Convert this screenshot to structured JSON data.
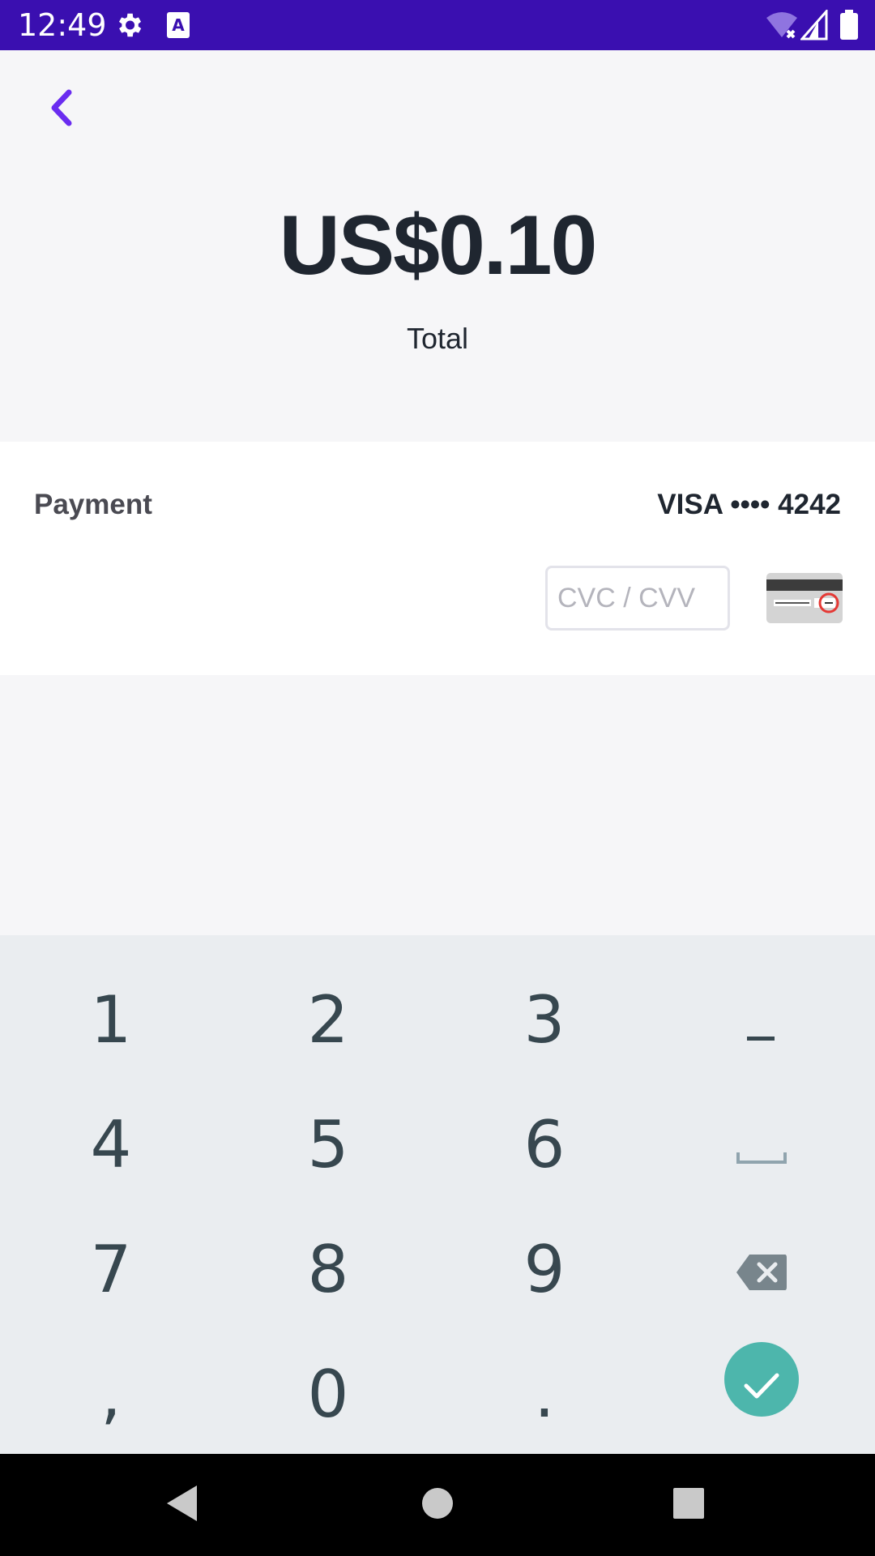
{
  "status_bar": {
    "time": "12:49",
    "icons": [
      "settings-icon",
      "a11y-a-icon",
      "wifi-off-icon",
      "signal-icon",
      "battery-icon"
    ],
    "background": "#3a0fb0"
  },
  "header": {
    "back_icon": "chevron-left-icon",
    "amount": "US$0.10",
    "amount_label": "Total",
    "accent": "#6a2cf0"
  },
  "payment": {
    "label": "Payment",
    "card_summary": "VISA •••• 4242",
    "cvc_placeholder": "CVC / CVV",
    "cvc_value": "",
    "card_icon": "card-back-cvc-icon"
  },
  "keypad": {
    "rows": [
      [
        "1",
        "2",
        "3",
        "–"
      ],
      [
        "4",
        "5",
        "6",
        "space"
      ],
      [
        "7",
        "8",
        "9",
        "backspace"
      ],
      [
        ",",
        "0",
        ".",
        "done"
      ]
    ],
    "done_color": "#4db6ac"
  },
  "nav": {
    "buttons": [
      "back-triangle-icon",
      "home-circle-icon",
      "recents-square-icon"
    ]
  }
}
